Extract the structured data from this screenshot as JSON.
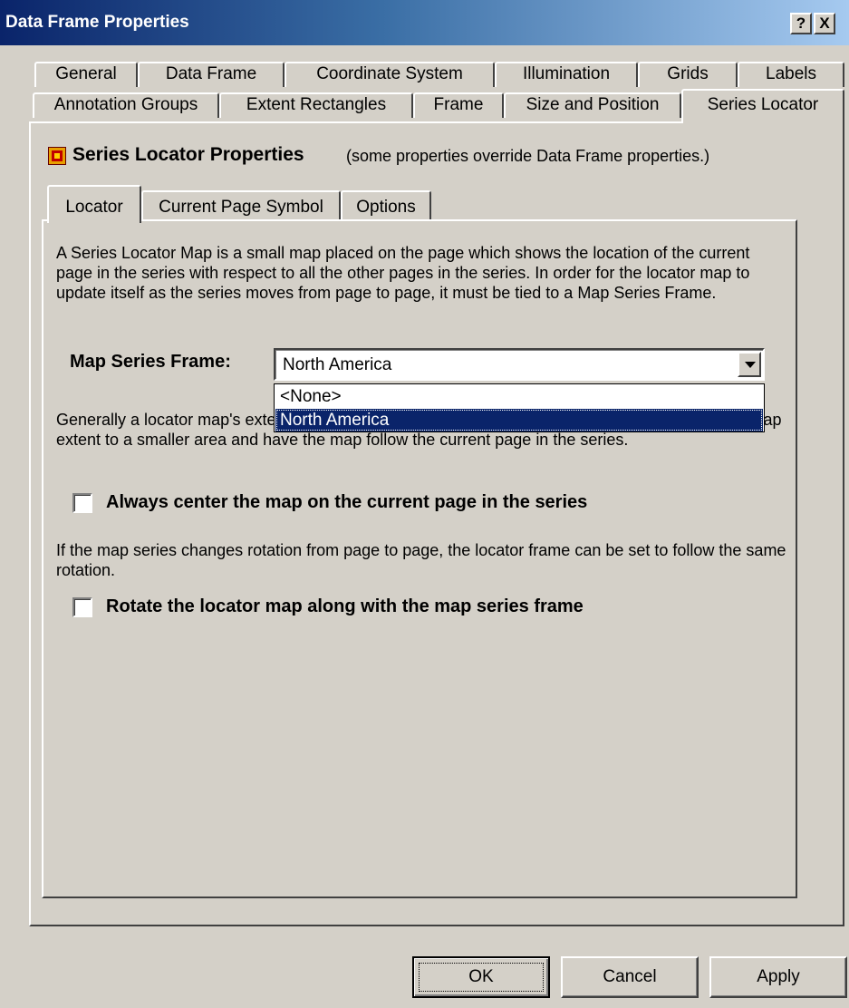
{
  "window": {
    "title": "Data Frame Properties",
    "help_glyph": "?",
    "close_glyph": "X"
  },
  "tabs_row1": [
    "General",
    "Data Frame",
    "Coordinate System",
    "Illumination",
    "Grids",
    "Labels"
  ],
  "tabs_row2": [
    "Annotation Groups",
    "Extent Rectangles",
    "Frame",
    "Size and Position",
    "Series Locator"
  ],
  "active_tab": "Series Locator",
  "panel": {
    "heading": "Series Locator Properties",
    "heading_note": "(some properties override Data Frame properties.)",
    "icon": "series-locator-icon"
  },
  "subtabs": [
    "Locator",
    "Current Page Symbol",
    "Options"
  ],
  "active_subtab": "Locator",
  "locator": {
    "intro": "A Series Locator Map is a small map placed on the page which shows the location of the current page in the series with respect to all the other pages in the series.  In order for the locator map to update itself as the series moves from page to page, it must be tied to a Map Series Frame.",
    "map_series_frame_label": "Map Series Frame:",
    "map_series_frame_value": "North America",
    "dropdown_options": [
      "<None>",
      "North America"
    ],
    "selected_option": "North America",
    "extent_text": "Generally a locator map's extent shows all the pages in the series. Alternatively, you can set the map extent to a smaller area and have the map follow the current page in the series.",
    "center_checkbox_label": "Always center the map on the current page in the series",
    "center_checked": false,
    "rotation_text": "If the map series changes rotation from page to page, the locator frame can be set to follow the same rotation.",
    "rotate_checkbox_label": "Rotate the locator map along with the map series frame",
    "rotate_checked": false
  },
  "buttons": {
    "ok": "OK",
    "cancel": "Cancel",
    "apply": "Apply"
  }
}
